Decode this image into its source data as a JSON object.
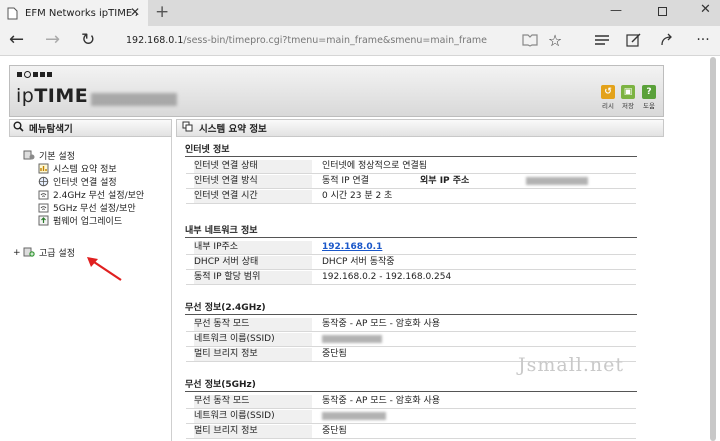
{
  "browser": {
    "tab_title": "EFM Networks ipTIME A",
    "url_main": "192.168.0.1",
    "url_rest": "/sess-bin/timepro.cgi?tmenu=main_frame&smenu=main_frame",
    "icons": [
      "back-arrow-icon",
      "forward-arrow-icon",
      "refresh-icon",
      "reading-view-icon",
      "favorite-star-icon",
      "hub-icon",
      "web-note-icon",
      "share-icon"
    ]
  },
  "header": {
    "logo": "ipTIME",
    "buttons": [
      {
        "label": "리시",
        "color": "#e3a21a"
      },
      {
        "label": "저장",
        "color": "#7cb342"
      },
      {
        "label": "도움",
        "color": "#5aa13a"
      }
    ]
  },
  "menu": {
    "title": "메뉴탐색기",
    "basic": {
      "label": "기본 설정",
      "items": [
        "시스템 요약 정보",
        "인터넷 연결 설정",
        "2.4GHz 무선 설정/보안",
        "5GHz 무선 설정/보안",
        "펌웨어 업그레이드"
      ]
    },
    "advanced": {
      "plus": "+",
      "label": "고급 설정"
    }
  },
  "content": {
    "title": "시스템 요약 정보",
    "internet": {
      "title": "인터넷 정보",
      "status_label": "인터넷 연결 상태",
      "status_value": "인터넷에 정상적으로 연결됨",
      "method_label": "인터넷 연결 방식",
      "method_value": "동적 IP 연결",
      "ext_ip_label": "외부 IP 주소",
      "time_label": "인터넷 연결 시간",
      "time_value": "0 시간 23 분 2 초"
    },
    "internal": {
      "title": "내부 네트워크 정보",
      "ip_label": "내부 IP주소",
      "ip_value": "192.168.0.1",
      "dhcp_label": "DHCP 서버 상태",
      "dhcp_value": "DHCP 서버 동작중",
      "range_label": "동적 IP 할당 범위",
      "range_value": "192.168.0.2  -  192.168.0.254"
    },
    "wifi24": {
      "title": "무선 정보(2.4GHz)",
      "mode_label": "무선 동작 모드",
      "mode_value": "동작중 - AP 모드 - 암호화 사용",
      "ssid_label": "네트워크 이름(SSID)",
      "bridge_label": "멀티 브리지 정보",
      "bridge_value": "중단됨"
    },
    "wifi5": {
      "title": "무선 정보(5GHz)",
      "mode_label": "무선 동작 모드",
      "mode_value": "동작중 - AP 모드 - 암호화 사용",
      "ssid_label": "네트워크 이름(SSID)",
      "bridge_label": "멀티 브리지 정보",
      "bridge_value": "중단됨"
    }
  },
  "watermark": "Jsmall.net"
}
